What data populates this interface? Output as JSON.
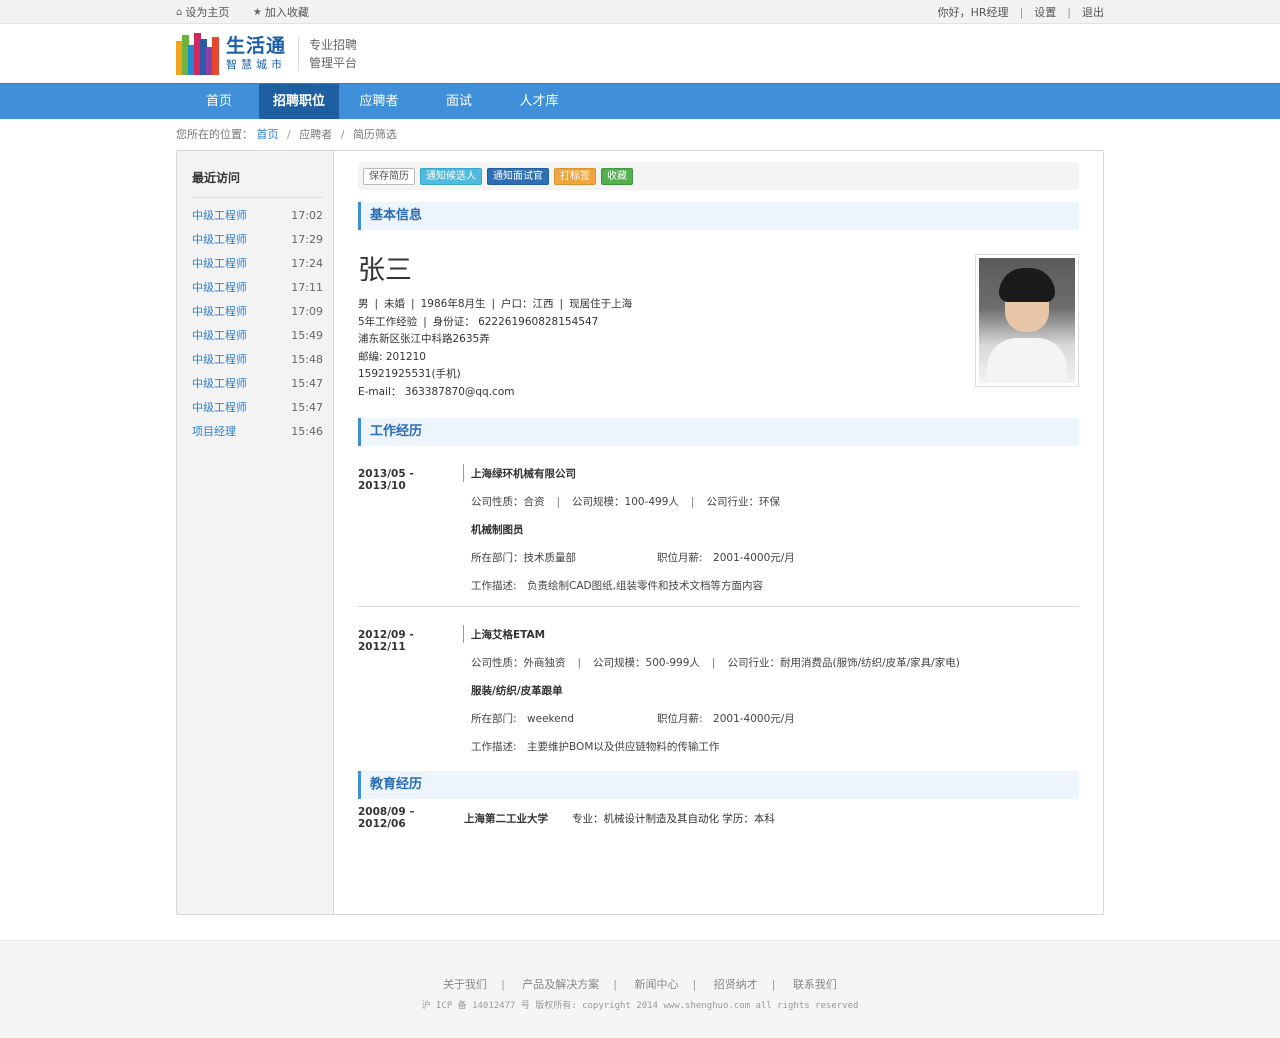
{
  "topbar": {
    "set_home": "设为主页",
    "add_fav": "加入收藏",
    "greeting": "你好，HR经理",
    "settings": "设置",
    "logout": "退出"
  },
  "header": {
    "logo_big": "生活通",
    "logo_small": "智慧城市",
    "slogan_line1": "专业招聘",
    "slogan_line2": "管理平台"
  },
  "nav": {
    "items": [
      {
        "label": "首页"
      },
      {
        "label": "招聘职位",
        "active": true
      },
      {
        "label": "应聘者"
      },
      {
        "label": "面试"
      },
      {
        "label": "人才库"
      }
    ]
  },
  "breadcrumb": {
    "prefix": "您所在的位置：",
    "home": "首页",
    "level2": "应聘者",
    "level3": "简历筛选"
  },
  "sidebar": {
    "title": "最近访问",
    "items": [
      {
        "job": "中级工程师",
        "time": "17:02"
      },
      {
        "job": "中级工程师",
        "time": "17:29"
      },
      {
        "job": "中级工程师",
        "time": "17:24"
      },
      {
        "job": "中级工程师",
        "time": "17:11"
      },
      {
        "job": "中级工程师",
        "time": "17:09"
      },
      {
        "job": "中级工程师",
        "time": "15:49"
      },
      {
        "job": "中级工程师",
        "time": "15:48"
      },
      {
        "job": "中级工程师",
        "time": "15:47"
      },
      {
        "job": "中级工程师",
        "time": "15:47"
      },
      {
        "job": "项目经理",
        "time": "15:46"
      }
    ]
  },
  "toolbar": {
    "save": "保存简历",
    "notify_candidate": "通知候选人",
    "notify_interviewer": "通知面试官",
    "tag": "打标签",
    "favorite": "收藏"
  },
  "basic": {
    "section_title": "基本信息",
    "name": "张三",
    "gender": "男",
    "marital": "未婚",
    "birth": "1986年8月生",
    "hukou": "户口：江西",
    "residence": "现居住于上海",
    "experience": "5年工作经验",
    "id_card": "身份证： 622261960828154547",
    "address": "浦东新区张江中科路2635弄",
    "zipcode": "邮编: 201210",
    "phone": "15921925531(手机)",
    "email": "E-mail： 363387870@qq.com"
  },
  "work": {
    "section_title": "工作经历",
    "entries": [
      {
        "period": "2013/05 - 2013/10",
        "company": "上海绿环机械有限公司",
        "nature": "公司性质：合资",
        "scale": "公司规模：100-499人",
        "industry": "公司行业：环保",
        "position": "机械制图员",
        "dept": "所在部门：技术质量部",
        "salary": "职位月薪:　2001-4000元/月",
        "desc": "工作描述:　负责绘制CAD图纸,组装零件和技术文档等方面内容"
      },
      {
        "period": "2012/09 - 2012/11",
        "company": "上海艾格ETAM",
        "nature": "公司性质：外商独资",
        "scale": "公司规模：500-999人",
        "industry": "公司行业：耐用消费品(服饰/纺织/皮革/家具/家电)",
        "position": "服装/纺织/皮革跟单",
        "dept": "所在部门:　weekend",
        "salary": "职位月薪:　2001-4000元/月",
        "desc": "工作描述:　主要维护BOM以及供应链物料的传输工作"
      }
    ]
  },
  "education": {
    "section_title": "教育经历",
    "period": "2008/09 – 2012/06",
    "school": "上海第二工业大学",
    "detail": "专业：机械设计制造及其自动化 学历：本科"
  },
  "footer": {
    "links": [
      "关于我们",
      "产品及解决方案",
      "新闻中心",
      "招贤纳才",
      "联系我们"
    ],
    "copyright": "沪 ICP 备 14012477 号 版权所有: copyright 2014 www.shenghuo.com all rights reserved"
  }
}
